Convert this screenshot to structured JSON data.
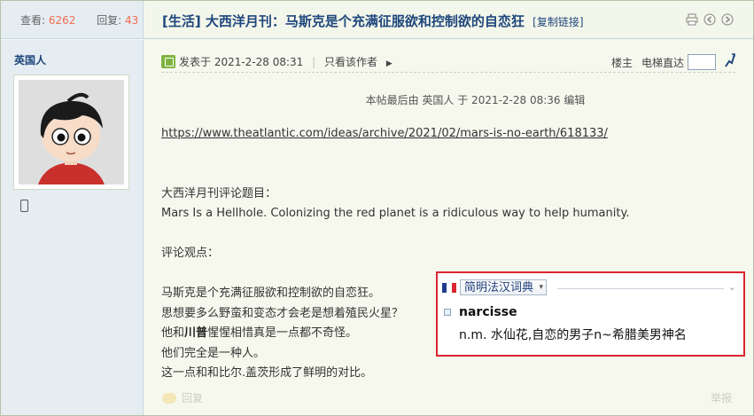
{
  "header": {
    "views_label": "查看:",
    "views_count": "6262",
    "replies_label": "回复:",
    "replies_count": "43",
    "title": "[生活] 大西洋月刊：马斯克是个充满征服欲和控制欲的自恋狂",
    "copy_link": "[复制链接]",
    "icons": [
      "print-icon",
      "prev-thread-icon",
      "next-thread-icon"
    ]
  },
  "sidebar": {
    "author": "英国人",
    "device_icon": "mobile-icon"
  },
  "post": {
    "meta": {
      "posted": "发表于 2021-2-28 08:31",
      "only_author": "只看该作者",
      "floor": "楼主",
      "jump_label": "电梯直达",
      "jump_value": ""
    },
    "edit_note": "本帖最后由 英国人 于 2021-2-28 08:36 编辑",
    "link": "https://www.theatlantic.com/ideas/archive/2021/02/mars-is-no-earth/618133/",
    "lines": {
      "topic_label": "大西洋月刊评论题目：",
      "topic": "Mars Is a Hellhole. Colonizing the red planet is a ridiculous way to help humanity.",
      "opinion_label": "评论观点：",
      "p1": "马斯克是个充满征服欲和控制欲的自恋狂。",
      "p2": "思想要多么野蛮和变态才会老是想着殖民火星？",
      "p3_a": "他和",
      "p3_b": "川普",
      "p3_c": "惺惺相惜真是一点都不奇怪。",
      "p4": "他们完全是一种人。",
      "p5": "这一点和和比尔.盖茨形成了鲜明的对比。"
    },
    "footer": {
      "reply": "回复",
      "report": "举报"
    }
  },
  "dictionary": {
    "source": "简明法汉词典",
    "word": "narcisse",
    "definition": "n.m. 水仙花,自恋的男子n~希腊美男神名",
    "flag_colors": [
      "#1f3b8f",
      "#ffffff",
      "#d8262f"
    ]
  }
}
